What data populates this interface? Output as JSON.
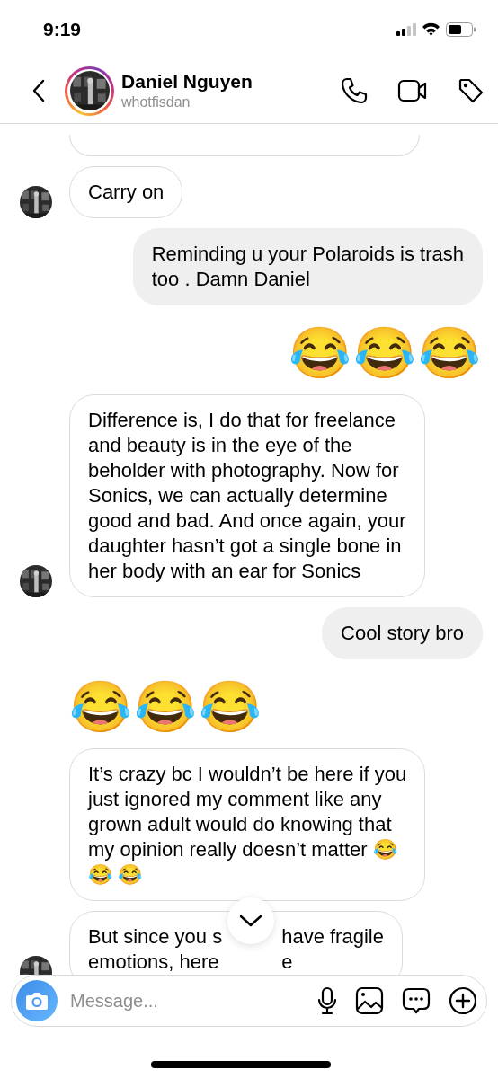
{
  "status_bar": {
    "time": "9:19"
  },
  "header": {
    "name": "Daniel Nguyen",
    "username": "whotfisdan",
    "has_story": true
  },
  "messages": [
    {
      "kind": "received_cut",
      "show_avatar": false
    },
    {
      "kind": "received",
      "text": "Carry on",
      "show_avatar": true
    },
    {
      "kind": "sent",
      "text": "Reminding u your Polaroids is trash\ntoo . Damn Daniel"
    },
    {
      "kind": "sent_emoji",
      "text": "😂😂😂"
    },
    {
      "kind": "received",
      "text": "Difference is, I do that for freelance\nand beauty is in the eye of the\nbeholder with photography. Now for\nSonics, we can actually determine\ngood and bad. And once again, your\ndaughter hasn’t got a single bone in\nher body with an ear for Sonics",
      "show_avatar": true
    },
    {
      "kind": "sent",
      "text": "Cool story bro"
    },
    {
      "kind": "received_emoji",
      "text": "😂😂😂",
      "show_avatar": false
    },
    {
      "kind": "received",
      "text": "It’s crazy bc I wouldn’t be here if you\njust ignored my comment like any\ngrown adult would do knowing that\nmy opinion really doesn’t matter 😂\n😂 😂",
      "show_avatar": false
    },
    {
      "kind": "received_covered",
      "segments": [
        "But since you s",
        "have fragile",
        "emotions, here",
        "e"
      ],
      "show_avatar": true
    }
  ],
  "composer": {
    "placeholder": "Message..."
  }
}
